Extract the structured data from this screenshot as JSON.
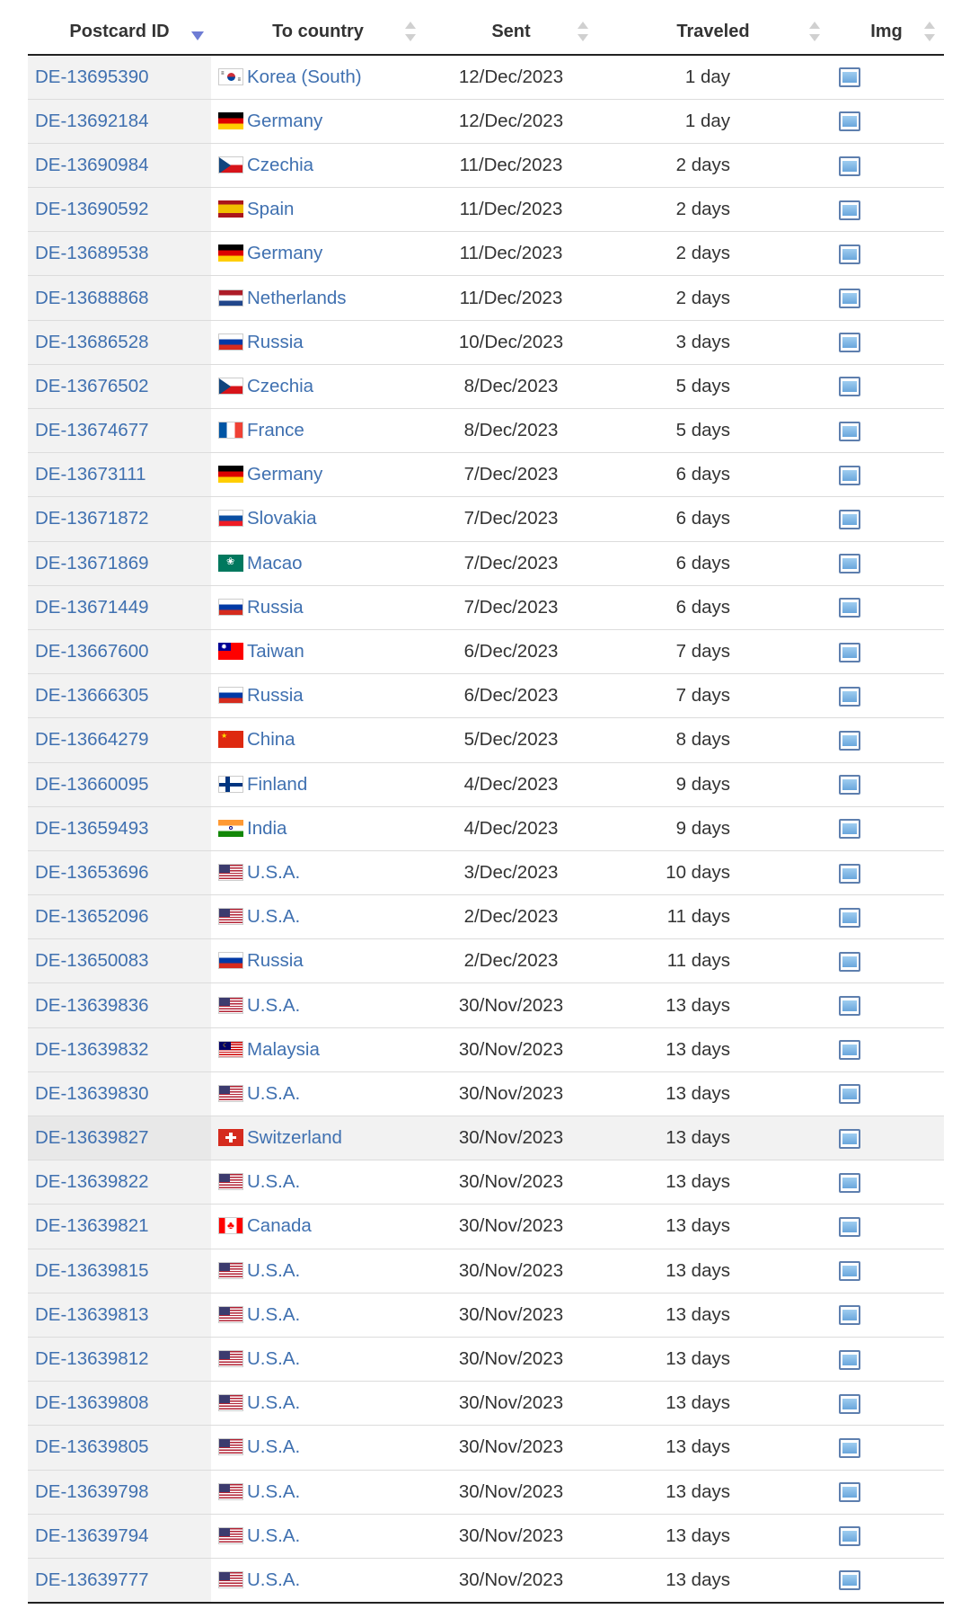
{
  "table": {
    "columns": [
      {
        "key": "id",
        "label": "Postcard ID",
        "sort": "desc"
      },
      {
        "key": "country",
        "label": "To country",
        "sort": "none"
      },
      {
        "key": "sent",
        "label": "Sent",
        "sort": "none"
      },
      {
        "key": "traveled",
        "label": "Traveled",
        "sort": "none"
      },
      {
        "key": "img",
        "label": "Img",
        "sort": "none"
      }
    ],
    "highlighted_row": "DE-13639827",
    "rows": [
      {
        "id": "DE-13695390",
        "flag": "kr",
        "country": "Korea (South)",
        "sent": "12/Dec/2023",
        "traveled": "1 day",
        "img": "image-icon"
      },
      {
        "id": "DE-13692184",
        "flag": "de",
        "country": "Germany",
        "sent": "12/Dec/2023",
        "traveled": "1 day",
        "img": "image-icon"
      },
      {
        "id": "DE-13690984",
        "flag": "cz",
        "country": "Czechia",
        "sent": "11/Dec/2023",
        "traveled": "2 days",
        "img": "image-icon"
      },
      {
        "id": "DE-13690592",
        "flag": "es",
        "country": "Spain",
        "sent": "11/Dec/2023",
        "traveled": "2 days",
        "img": "image-icon"
      },
      {
        "id": "DE-13689538",
        "flag": "de",
        "country": "Germany",
        "sent": "11/Dec/2023",
        "traveled": "2 days",
        "img": "image-icon"
      },
      {
        "id": "DE-13688868",
        "flag": "nl",
        "country": "Netherlands",
        "sent": "11/Dec/2023",
        "traveled": "2 days",
        "img": "image-icon"
      },
      {
        "id": "DE-13686528",
        "flag": "ru",
        "country": "Russia",
        "sent": "10/Dec/2023",
        "traveled": "3 days",
        "img": "image-icon"
      },
      {
        "id": "DE-13676502",
        "flag": "cz",
        "country": "Czechia",
        "sent": "8/Dec/2023",
        "traveled": "5 days",
        "img": "image-icon"
      },
      {
        "id": "DE-13674677",
        "flag": "fr",
        "country": "France",
        "sent": "8/Dec/2023",
        "traveled": "5 days",
        "img": "image-icon"
      },
      {
        "id": "DE-13673111",
        "flag": "de",
        "country": "Germany",
        "sent": "7/Dec/2023",
        "traveled": "6 days",
        "img": "image-icon"
      },
      {
        "id": "DE-13671872",
        "flag": "sk",
        "country": "Slovakia",
        "sent": "7/Dec/2023",
        "traveled": "6 days",
        "img": "image-icon"
      },
      {
        "id": "DE-13671869",
        "flag": "mo",
        "country": "Macao",
        "sent": "7/Dec/2023",
        "traveled": "6 days",
        "img": "image-icon"
      },
      {
        "id": "DE-13671449",
        "flag": "ru",
        "country": "Russia",
        "sent": "7/Dec/2023",
        "traveled": "6 days",
        "img": "image-icon"
      },
      {
        "id": "DE-13667600",
        "flag": "tw",
        "country": "Taiwan",
        "sent": "6/Dec/2023",
        "traveled": "7 days",
        "img": "image-icon"
      },
      {
        "id": "DE-13666305",
        "flag": "ru",
        "country": "Russia",
        "sent": "6/Dec/2023",
        "traveled": "7 days",
        "img": "image-icon"
      },
      {
        "id": "DE-13664279",
        "flag": "cn",
        "country": "China",
        "sent": "5/Dec/2023",
        "traveled": "8 days",
        "img": "image-icon"
      },
      {
        "id": "DE-13660095",
        "flag": "fi",
        "country": "Finland",
        "sent": "4/Dec/2023",
        "traveled": "9 days",
        "img": "image-icon"
      },
      {
        "id": "DE-13659493",
        "flag": "in",
        "country": "India",
        "sent": "4/Dec/2023",
        "traveled": "9 days",
        "img": "image-icon"
      },
      {
        "id": "DE-13653696",
        "flag": "us",
        "country": "U.S.A.",
        "sent": "3/Dec/2023",
        "traveled": "10 days",
        "img": "image-icon"
      },
      {
        "id": "DE-13652096",
        "flag": "us",
        "country": "U.S.A.",
        "sent": "2/Dec/2023",
        "traveled": "11 days",
        "img": "image-icon"
      },
      {
        "id": "DE-13650083",
        "flag": "ru",
        "country": "Russia",
        "sent": "2/Dec/2023",
        "traveled": "11 days",
        "img": "image-icon"
      },
      {
        "id": "DE-13639836",
        "flag": "us",
        "country": "U.S.A.",
        "sent": "30/Nov/2023",
        "traveled": "13 days",
        "img": "image-icon"
      },
      {
        "id": "DE-13639832",
        "flag": "my",
        "country": "Malaysia",
        "sent": "30/Nov/2023",
        "traveled": "13 days",
        "img": "image-icon"
      },
      {
        "id": "DE-13639830",
        "flag": "us",
        "country": "U.S.A.",
        "sent": "30/Nov/2023",
        "traveled": "13 days",
        "img": "image-icon"
      },
      {
        "id": "DE-13639827",
        "flag": "ch",
        "country": "Switzerland",
        "sent": "30/Nov/2023",
        "traveled": "13 days",
        "img": "image-icon"
      },
      {
        "id": "DE-13639822",
        "flag": "us",
        "country": "U.S.A.",
        "sent": "30/Nov/2023",
        "traveled": "13 days",
        "img": "image-icon"
      },
      {
        "id": "DE-13639821",
        "flag": "ca",
        "country": "Canada",
        "sent": "30/Nov/2023",
        "traveled": "13 days",
        "img": "image-icon"
      },
      {
        "id": "DE-13639815",
        "flag": "us",
        "country": "U.S.A.",
        "sent": "30/Nov/2023",
        "traveled": "13 days",
        "img": "image-icon"
      },
      {
        "id": "DE-13639813",
        "flag": "us",
        "country": "U.S.A.",
        "sent": "30/Nov/2023",
        "traveled": "13 days",
        "img": "image-icon"
      },
      {
        "id": "DE-13639812",
        "flag": "us",
        "country": "U.S.A.",
        "sent": "30/Nov/2023",
        "traveled": "13 days",
        "img": "image-icon"
      },
      {
        "id": "DE-13639808",
        "flag": "us",
        "country": "U.S.A.",
        "sent": "30/Nov/2023",
        "traveled": "13 days",
        "img": "image-icon"
      },
      {
        "id": "DE-13639805",
        "flag": "us",
        "country": "U.S.A.",
        "sent": "30/Nov/2023",
        "traveled": "13 days",
        "img": "image-icon"
      },
      {
        "id": "DE-13639798",
        "flag": "us",
        "country": "U.S.A.",
        "sent": "30/Nov/2023",
        "traveled": "13 days",
        "img": "image-icon"
      },
      {
        "id": "DE-13639794",
        "flag": "us",
        "country": "U.S.A.",
        "sent": "30/Nov/2023",
        "traveled": "13 days",
        "img": "image-icon"
      },
      {
        "id": "DE-13639777",
        "flag": "us",
        "country": "U.S.A.",
        "sent": "30/Nov/2023",
        "traveled": "13 days",
        "img": "image-icon"
      }
    ]
  },
  "colors": {
    "link": "#3f70b0",
    "sort_active": "#6e7cd4",
    "id_column_bg": "#f2f2f2",
    "row_divider": "#dcdcdc"
  }
}
